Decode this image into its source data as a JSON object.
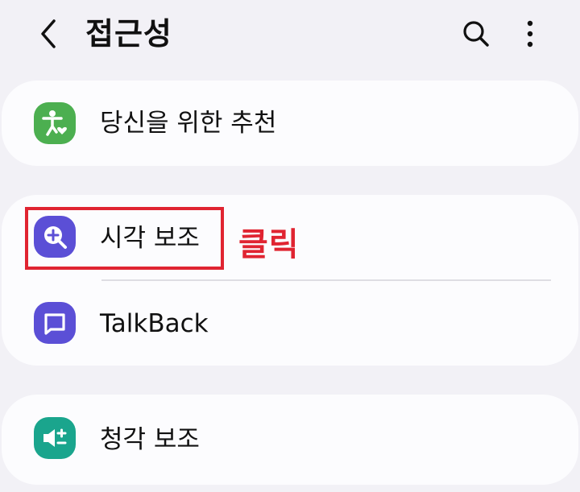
{
  "header": {
    "title": "접근성",
    "back_icon": "back-arrow-icon",
    "search_icon": "search-icon",
    "more_icon": "more-options-icon"
  },
  "sections": [
    {
      "items": [
        {
          "label": "당신을 위한 추천",
          "icon": "accessibility-person-heart-icon",
          "icon_color": "#4caf50"
        }
      ]
    },
    {
      "items": [
        {
          "label": "시각 보조",
          "icon": "magnifier-plus-icon",
          "icon_color": "#5b4fd6"
        },
        {
          "label": "TalkBack",
          "icon": "speech-bubble-icon",
          "icon_color": "#5b4fd6"
        }
      ]
    },
    {
      "items": [
        {
          "label": "청각 보조",
          "icon": "speaker-hearing-icon",
          "icon_color": "#1aa58d"
        }
      ]
    }
  ],
  "annotation": {
    "text": "클릭",
    "color": "#e02431"
  }
}
